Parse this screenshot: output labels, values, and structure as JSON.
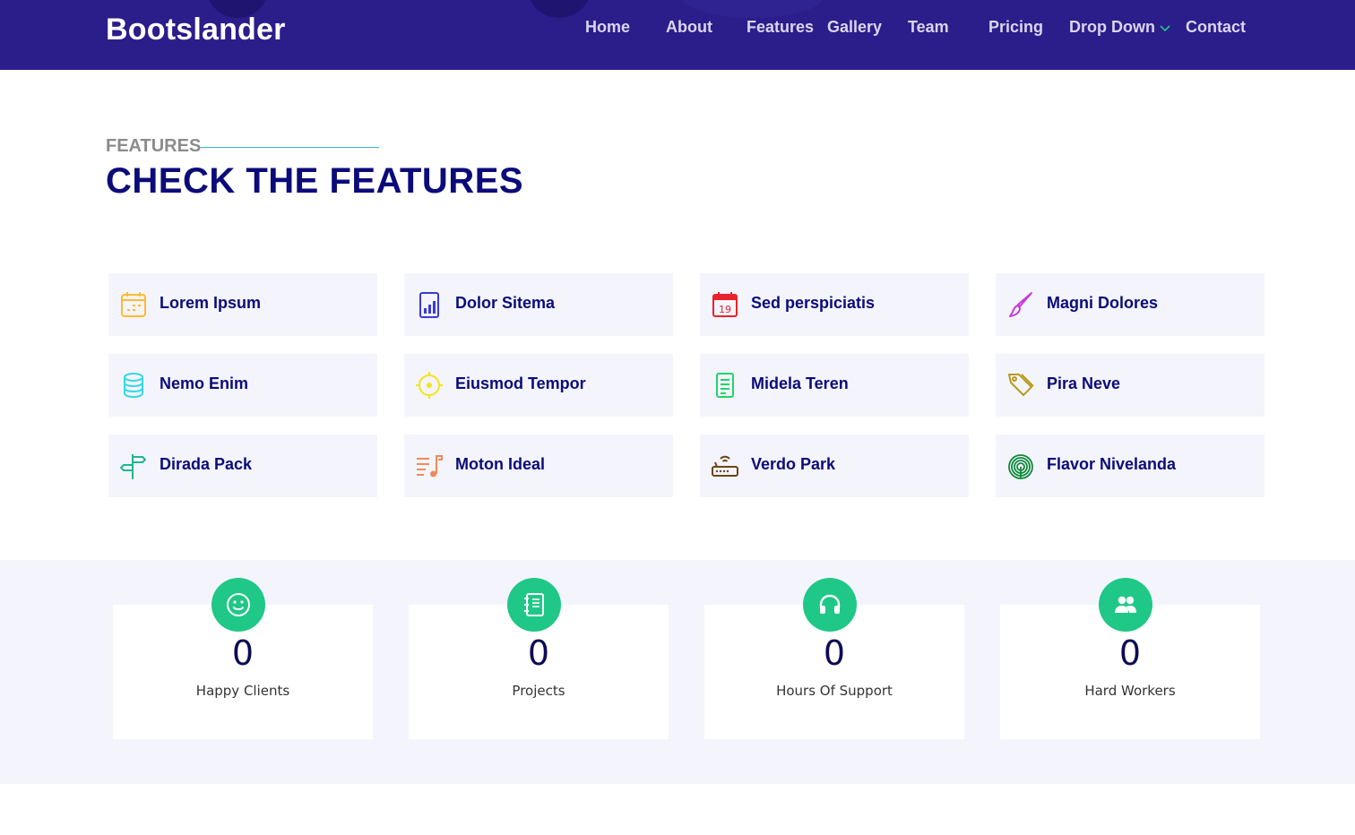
{
  "brand": {
    "logo_text": "Bootslander"
  },
  "nav": {
    "items": [
      "Home",
      "About",
      "Features",
      "Gallery",
      "Team",
      "Pricing",
      "Drop Down",
      "Contact"
    ]
  },
  "features_section": {
    "kicker": "FEATURES",
    "title": "CHECK THE FEATURES",
    "items": [
      {
        "label": "Lorem Ipsum",
        "icon": "calendar-grid-icon",
        "color": "#ffbb2c"
      },
      {
        "label": "Dolor Sitema",
        "icon": "bar-chart-icon",
        "color": "#5578ff"
      },
      {
        "label": "Sed perspiciatis",
        "icon": "calendar-date-icon",
        "color": "#e80368",
        "icon_text": "19"
      },
      {
        "label": "Magni Dolores",
        "icon": "paint-brush-icon",
        "color": "#e361ff"
      },
      {
        "label": "Nemo Enim",
        "icon": "database-icon",
        "color": "#47aeff"
      },
      {
        "label": "Eiusmod Tempor",
        "icon": "target-icon",
        "color": "#ffa76e"
      },
      {
        "label": "Midela Teren",
        "icon": "document-icon",
        "color": "#11dbcf"
      },
      {
        "label": "Pira Neve",
        "icon": "price-tag-icon",
        "color": "#4233ff"
      },
      {
        "label": "Dirada Pack",
        "icon": "signpost-icon",
        "color": "#b2904f"
      },
      {
        "label": "Moton Ideal",
        "icon": "music-list-icon",
        "color": "#b20969"
      },
      {
        "label": "Verdo Park",
        "icon": "router-icon",
        "color": "#ff5828"
      },
      {
        "label": "Flavor Nivelanda",
        "icon": "fingerprint-icon",
        "color": "#29cc61"
      }
    ]
  },
  "counts": [
    {
      "value": "0",
      "label": "Happy Clients",
      "icon": "smile-icon"
    },
    {
      "value": "0",
      "label": "Projects",
      "icon": "journal-icon"
    },
    {
      "value": "0",
      "label": "Hours Of Support",
      "icon": "headset-icon"
    },
    {
      "value": "0",
      "label": "Hard Workers",
      "icon": "people-icon"
    }
  ],
  "colors": {
    "header_bg": "#2b1d8a",
    "title": "#0b0b7a",
    "card_bg": "#f4f4fd",
    "count_accent": "#1fc886"
  }
}
